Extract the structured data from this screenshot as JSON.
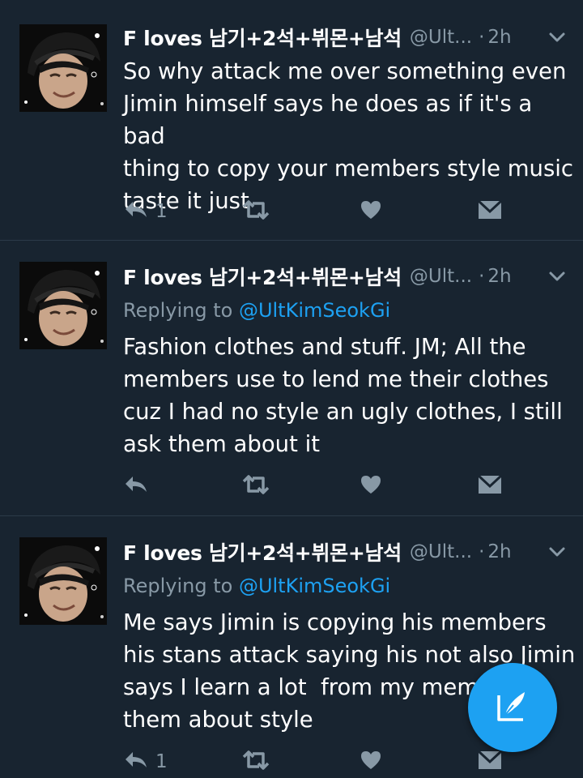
{
  "tweets": [
    {
      "name": "F loves 남기+2석+뷔몬+남석",
      "handle": "@Ult...",
      "time": "2h",
      "replying_prefix": "",
      "replying_handle": "",
      "text_lines": [
        "So why attack me over something even",
        "Jimin himself says he does as if it's a bad",
        "thing to copy your members style music",
        "taste it just"
      ],
      "reply_count": "1"
    },
    {
      "name": "F loves 남기+2석+뷔몬+남석",
      "handle": "@Ult...",
      "time": "2h",
      "replying_prefix": "Replying to ",
      "replying_handle": "@UltKimSeokGi",
      "text_lines": [
        "Fashion clothes and stuff. JM; All the",
        "members use to lend me their clothes",
        "cuz I had no style an ugly clothes, I still",
        "ask them about it"
      ],
      "reply_count": ""
    },
    {
      "name": "F loves 남기+2석+뷔몬+남석",
      "handle": "@Ult...",
      "time": "2h",
      "replying_prefix": "Replying to ",
      "replying_handle": "@UltKimSeokGi",
      "text_lines": [
        "Me says Jimin is copying his members",
        "his stans attack saying his not also Jimin",
        "says I learn a lot  from my membe   k",
        "them about style"
      ],
      "reply_count": "1"
    }
  ],
  "separator": "·",
  "icons": {
    "reply": "reply-arrow-icon",
    "retweet": "retweet-icon",
    "like": "heart-icon",
    "dm": "envelope-icon",
    "menu": "chevron-down-icon",
    "compose": "compose-feather-icon"
  },
  "colors": {
    "background": "#182430",
    "muted": "#8899a6",
    "accent": "#1da1f2",
    "text": "#ffffff"
  }
}
